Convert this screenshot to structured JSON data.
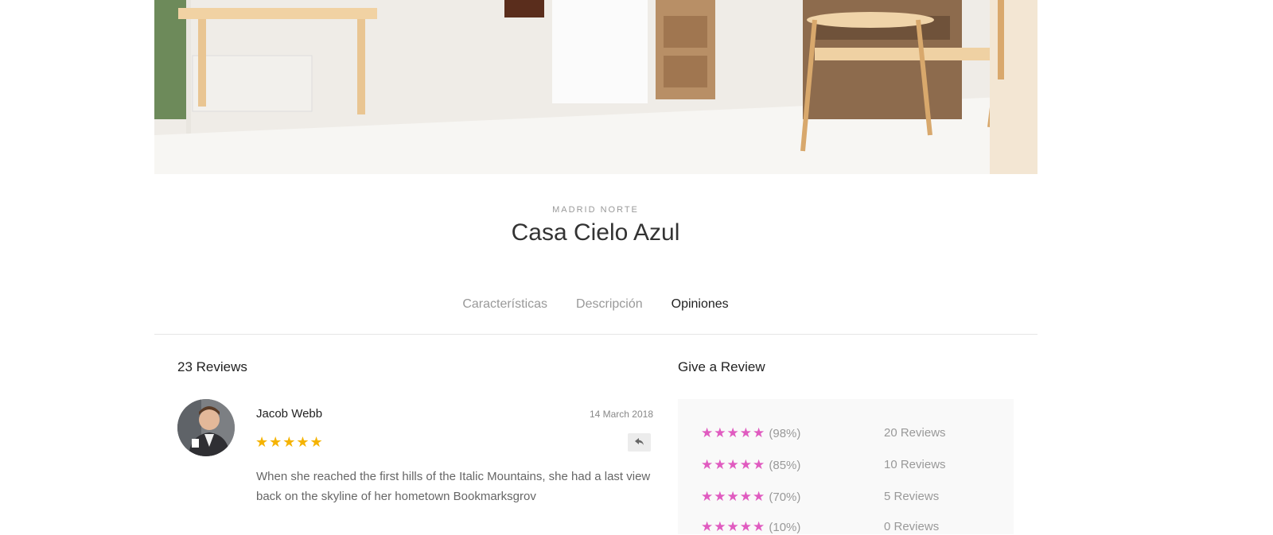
{
  "property": {
    "location": "MADRID NORTE",
    "name": "Casa Cielo Azul"
  },
  "tabs": [
    {
      "label": "Características"
    },
    {
      "label": "Descripción"
    },
    {
      "label": "Opiniones"
    }
  ],
  "reviews": {
    "count_label": "23 Reviews",
    "items": [
      {
        "author": "Jacob Webb",
        "date": "14 March 2018",
        "stars": "★★★★★",
        "rating": 5,
        "text": "When she reached the first hills of the Italic Mountains, she had a last view back on the skyline of her hometown Bookmarksgrov"
      }
    ]
  },
  "give_review": {
    "title": "Give a Review",
    "ratings": [
      {
        "stars": "★★★★★",
        "percent": "(98%)",
        "count": "20 Reviews"
      },
      {
        "stars": "★★★★★",
        "percent": "(85%)",
        "count": "10 Reviews"
      },
      {
        "stars": "★★★★★",
        "percent": "(70%)",
        "count": "5 Reviews"
      },
      {
        "stars": "★★★★★",
        "percent": "(10%)",
        "count": "0 Reviews"
      }
    ]
  },
  "icons": {
    "reply": "reply-icon",
    "star": "star-icon"
  },
  "colors": {
    "review_stars": "#f5b301",
    "rating_stars": "#e05bc0"
  }
}
